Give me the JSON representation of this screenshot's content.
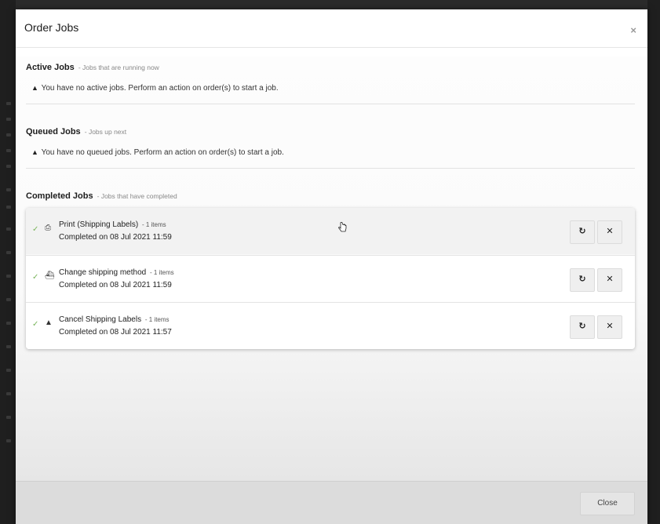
{
  "modal": {
    "title": "Order Jobs",
    "close_icon": "×"
  },
  "sections": {
    "active": {
      "heading": "Active Jobs",
      "subheading": "- Jobs that are running now",
      "empty_message": "You have no active jobs. Perform an action on order(s) to start a job."
    },
    "queued": {
      "heading": "Queued Jobs",
      "subheading": "- Jobs up next",
      "empty_message": "You have no queued jobs. Perform an action on order(s) to start a job."
    },
    "completed": {
      "heading": "Completed Jobs",
      "subheading": "- Jobs that have completed"
    }
  },
  "jobs": [
    {
      "title": "Print (Shipping Labels)",
      "items": "- 1 items",
      "completed": "Completed on 08 Jul 2021 11:59",
      "icon": "printer-icon",
      "icon_glyph": "⎙",
      "status_glyph": "✓",
      "retry_glyph": "↻",
      "remove_glyph": "✕"
    },
    {
      "title": "Change shipping method",
      "items": "- 1 items",
      "completed": "Completed on 08 Jul 2021 11:59",
      "icon": "ship-icon",
      "icon_glyph": "⛴",
      "status_glyph": "✓",
      "retry_glyph": "↻",
      "remove_glyph": "✕"
    },
    {
      "title": "Cancel Shipping Labels",
      "items": "- 1 items",
      "completed": "Completed on 08 Jul 2021 11:57",
      "icon": "warning-icon",
      "icon_glyph": "▲",
      "status_glyph": "✓",
      "retry_glyph": "↻",
      "remove_glyph": "✕"
    }
  ],
  "footer": {
    "close_label": "Close"
  },
  "colors": {
    "success_check": "#7ab55c",
    "backdrop": "#2b2b2b"
  }
}
